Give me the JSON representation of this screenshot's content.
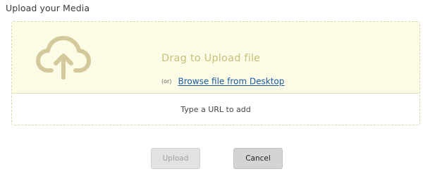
{
  "page": {
    "title": "Upload your Media"
  },
  "dropzone": {
    "icon": "cloud-upload-icon",
    "drag_text": "Drag to Upload file",
    "or_text": "(or)",
    "browse_link": "Browse file from Desktop",
    "background_color": "#fbfbe6",
    "accent_color": "#c9bf7a"
  },
  "url_field": {
    "placeholder": "Type a URL to add",
    "value": ""
  },
  "actions": {
    "upload_label": "Upload",
    "upload_disabled": true,
    "cancel_label": "Cancel"
  },
  "colors": {
    "link": "#1a5aa0",
    "dashed_border": "#dcd6a3"
  }
}
